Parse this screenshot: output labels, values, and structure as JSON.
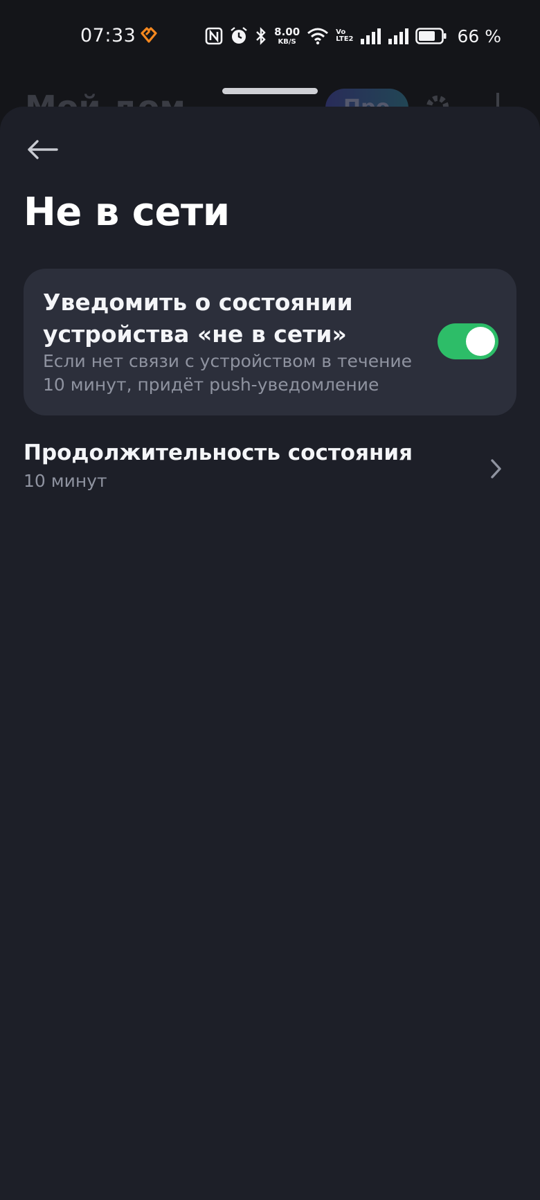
{
  "status_bar": {
    "time": "07:33",
    "app_icon": "heart-logo-icon",
    "icons": [
      "nfc-icon",
      "alarm-icon",
      "bluetooth-icon",
      "wifi-icon",
      "volte-icon",
      "signal-icon",
      "signal-icon",
      "battery-icon"
    ],
    "net_speed_value": "8.00",
    "net_speed_unit": "KB/S",
    "volte_top": "Vo",
    "volte_bottom": "LTE2",
    "battery_percent": "66 %",
    "accent_color": "#f5881f"
  },
  "background_app": {
    "title": "Мой дом",
    "pill_label": "Про"
  },
  "header": {
    "back_icon": "arrow-left-icon",
    "title": "Не в сети"
  },
  "notify_card": {
    "title": "Уведомить о состоянии устройства «не в сети»",
    "description": "Если нет связи с устройством в течение 10 минут, придёт push-уведомление",
    "toggle_on": true,
    "toggle_color": "#2dbd68"
  },
  "duration_row": {
    "title": "Продолжительность состояния",
    "value": "10 минут",
    "chevron_icon": "chevron-right-icon"
  },
  "colors": {
    "sheet_background": "#1d1f28",
    "card_background": "#2c2f3b",
    "secondary_text": "#8f93a0"
  }
}
